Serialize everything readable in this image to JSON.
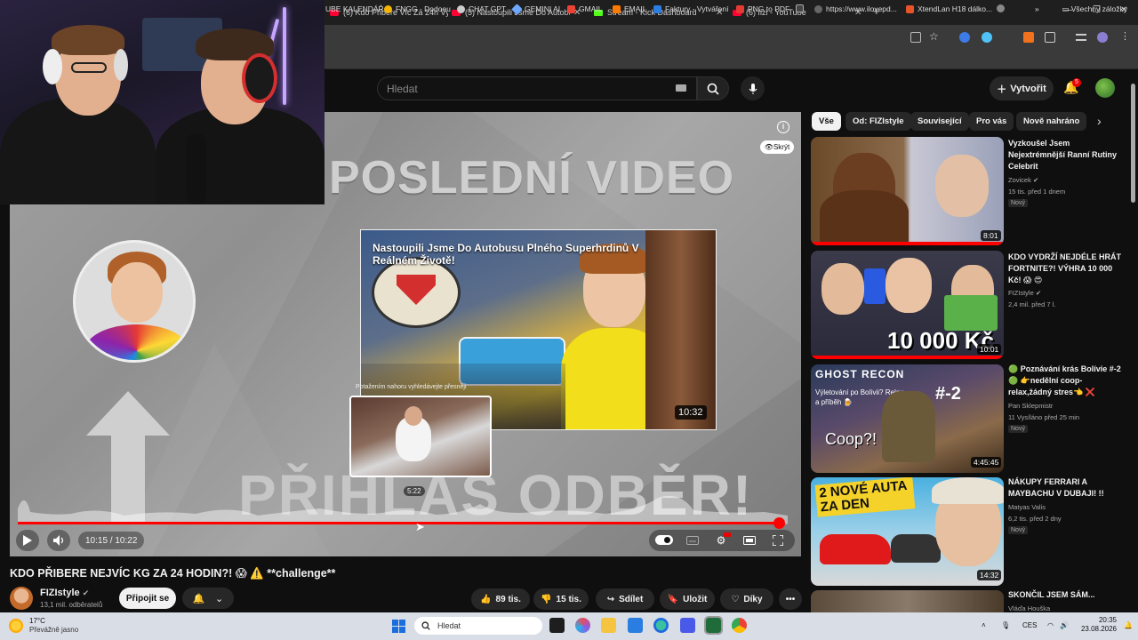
{
  "browser": {
    "tabs": [
      {
        "title": "(6) Kdo Přibere Víc Za 24h Vyhr",
        "active": false
      },
      {
        "title": "(5) Nastoupili Jsme Do Autobus",
        "active": false
      },
      {
        "title": "Stream - Kick Dashboard",
        "active": false
      },
      {
        "title": "(6) fizi - YouTube",
        "active": false
      }
    ],
    "new_tab": "+",
    "bookmarks": [
      {
        "label": "UBE KALENDÁŘ",
        "color": ""
      },
      {
        "label": "FNGG - Dodoeu",
        "color": "#f4b400"
      },
      {
        "label": "CHAT GPT",
        "color": "#cccccc"
      },
      {
        "label": "GEMINI AI",
        "color": "#6ea8ff"
      },
      {
        "label": "GMAIL",
        "color": "#ea4335"
      },
      {
        "label": "EMAIL",
        "color": "#ff7a00"
      },
      {
        "label": "Faktury - Vytváření",
        "color": "#2a7de1"
      },
      {
        "label": "PNG to PDF",
        "color": "#e53935"
      },
      {
        "label": "https://www.ilovepd...",
        "color": "#444444"
      },
      {
        "label": "XtendLan H18 dálko...",
        "color": "#e8542a"
      }
    ],
    "all_bookmarks": "Všechny záložky"
  },
  "header": {
    "search_placeholder": "Hledat",
    "create_label": "Vytvořit",
    "notifications": "5"
  },
  "player": {
    "end_title": "POSLEDNÍ VIDEO",
    "subscribe_text": "PŘIHLAS ODBĚR!",
    "hide_label": "Skrýt",
    "endcard_title": "Nastoupili Jsme Do Autobusu Plného Superhrdinů V Reálném Životě!",
    "endcard_duration": "10:32",
    "seek_hint": "Potažením nahoru vyhledávejte přesněji",
    "preview_time": "5:22",
    "time_display": "10:15 / 10:22",
    "progress": 0.9887
  },
  "video": {
    "title": "KDO PŘIBERE NEJVÍC KG ZA 24 HODIN?! 😱 ⚠️ **challenge**",
    "channel": "FIZIstyle",
    "subscribers": "13,1 mil. odběratelů",
    "join_label": "Připojit se",
    "likes": "89 tis.",
    "dislikes": "15 tis.",
    "share_label": "Sdílet",
    "save_label": "Uložit",
    "thanks_label": "Díky",
    "more_label": "•••"
  },
  "chips": [
    "Vše",
    "Od: FIZIstyle",
    "Související",
    "Pro vás",
    "Nově nahráno"
  ],
  "recommendations": [
    {
      "title": "Vyzkoušel Jsem Nejextrémnější Ranní Rutiny Celebrit",
      "channel": "Zovicek",
      "meta": "15 tis.  před 1 dnem",
      "badge": "Nový",
      "duration": "8:01",
      "thumb_text": ""
    },
    {
      "title": "KDO VYDRŽÍ NEJDÉLE HRÁT FORTNITE?! VÝHRA 10 000 Kč! 😱 😍",
      "channel": "FIZIstyle",
      "meta": "2,4 mil.  před 7 l.",
      "badge": "",
      "duration": "10:01",
      "thumb_text": "10 000 Kč"
    },
    {
      "title": "🟢 Poznávání krás Bolívie #-2 🟢 👉nedělní coop-relax,žádný stres👈 ❌",
      "channel": "Pan Sklepmistr",
      "meta": "11  Vysíláno před 25 min",
      "badge": "Nový",
      "duration": "4:45:45",
      "thumb_text": "Coop?!"
    },
    {
      "title": "NÁKUPY FERRARI A MAYBACHU V DUBAJI! !!",
      "channel": "Matyas Valis",
      "meta": "6,2 tis.  před 2 dny",
      "badge": "Nový",
      "duration": "14:32",
      "thumb_text": "2 NOVÉ AUTA ZA DEN"
    },
    {
      "title": "SKONČIL JSEM SÁM...",
      "channel": "Vláďa Houška",
      "meta": "",
      "badge": "",
      "duration": "",
      "thumb_text": ""
    }
  ],
  "thumb_overlays": {
    "rec3_brand": "GHOST RECON",
    "rec3_sub": "Výletování po Bolívii? Relax a příběh 🍺",
    "rec3_num": "#-2"
  },
  "taskbar": {
    "temp": "17°C",
    "weather": "Převážně jasno",
    "search": "Hledat",
    "lang": "CES",
    "time": "20:35",
    "date": "23.08.2026"
  }
}
